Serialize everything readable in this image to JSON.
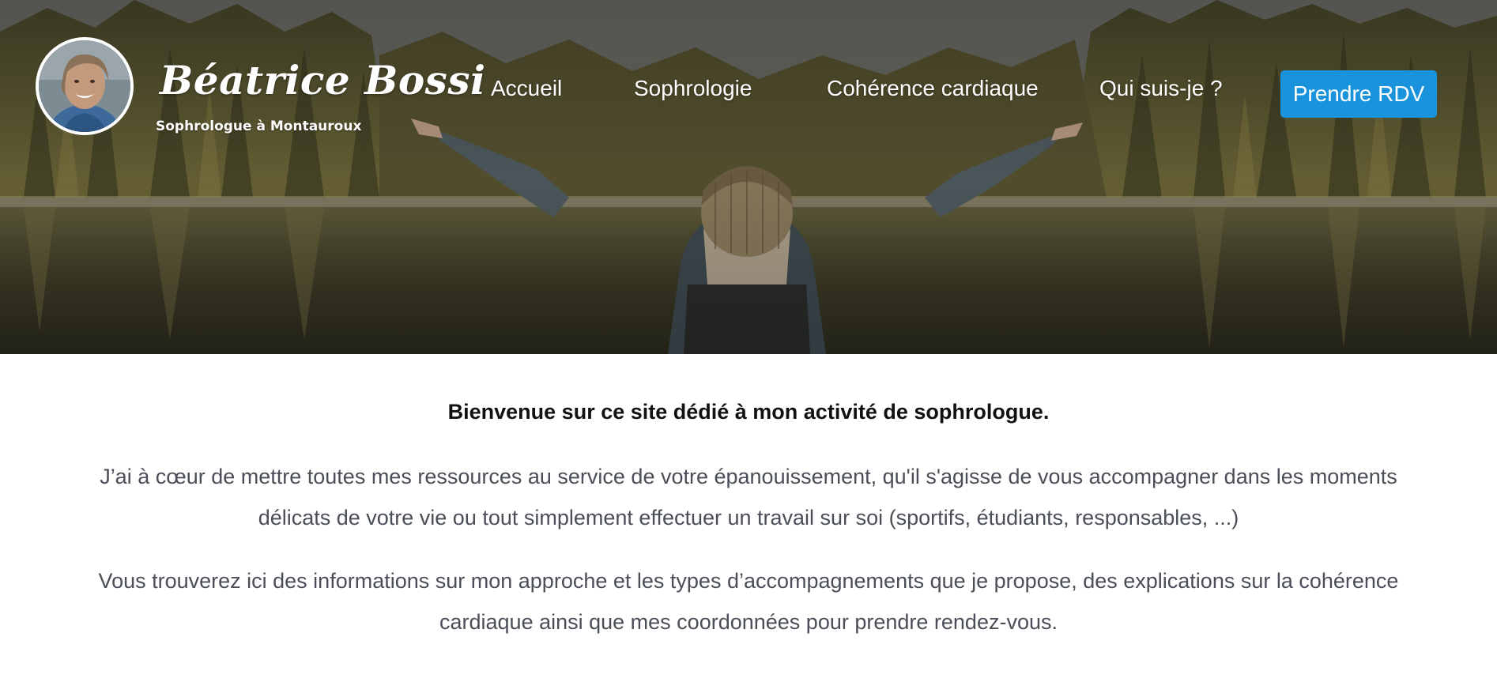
{
  "header": {
    "brand_name": "Béatrice Bossi",
    "brand_subtitle": "Sophrologue à Montauroux",
    "nav": [
      {
        "label": "Accueil"
      },
      {
        "label": "Sophrologie"
      },
      {
        "label": "Cohérence cardiaque"
      },
      {
        "label": "Qui suis-je ?"
      }
    ],
    "cta_label": "Prendre RDV"
  },
  "main": {
    "welcome": "Bienvenue sur ce site dédié à mon activité de sophrologue.",
    "paragraph1": "J’ai à cœur de mettre toutes mes ressources au service de votre épanouissement, qu'il s'agisse de vous accompagner dans les moments délicats de votre vie ou tout simplement effectuer un travail sur soi (sportifs, étudiants, responsables, ...)",
    "paragraph2": "Vous trouverez ici des informations sur mon approche et les types d’accompagnements que je propose, des explications sur la cohérence cardiaque ainsi que mes coordonnées pour prendre rendez-vous."
  },
  "colors": {
    "cta_background": "#1a93dd",
    "body_text": "#4a4e57",
    "heading_text": "#111111"
  }
}
